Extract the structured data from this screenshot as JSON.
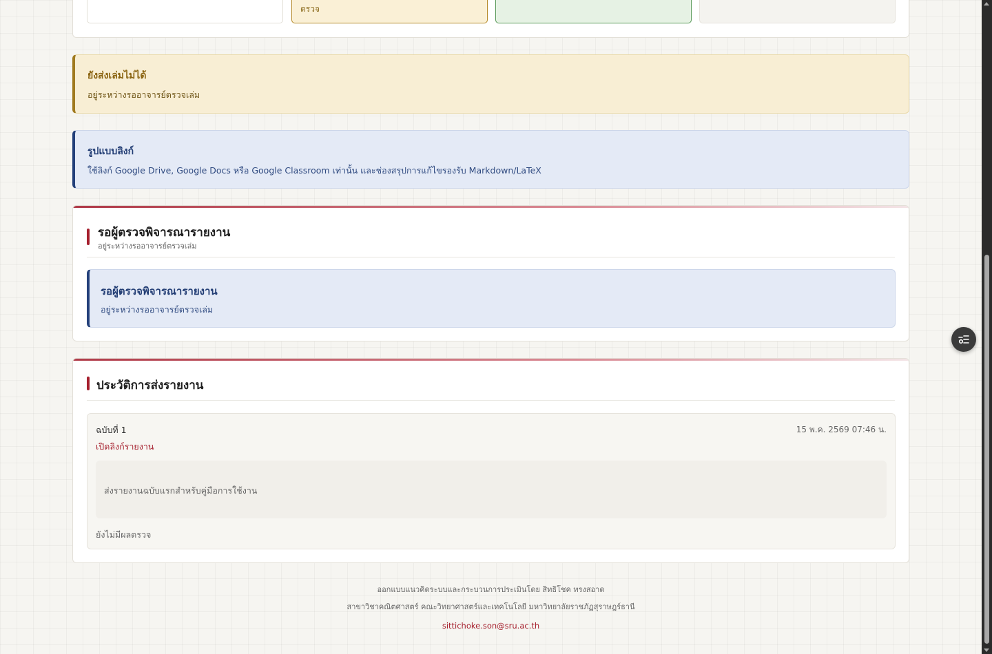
{
  "stats": {
    "pending_label": "ตรวจ"
  },
  "notice_submit": {
    "title": "ยังส่งเล่มไม่ได้",
    "text": "อยู่ระหว่างรออาจารย์ตรวจเล่ม"
  },
  "notice_link_format": {
    "title": "รูปแบบลิงก์",
    "text": "ใช้ลิงก์ Google Drive, Google Docs หรือ Google Classroom เท่านั้น และช่องสรุปการแก้ไขรองรับ Markdown/LaTeX"
  },
  "review_card": {
    "title": "รอผู้ตรวจพิจารณารายงาน",
    "subtitle": "อยู่ระหว่างรออาจารย์ตรวจเล่ม",
    "alert_title": "รอผู้ตรวจพิจารณารายงาน",
    "alert_text": "อยู่ระหว่างรออาจารย์ตรวจเล่ม"
  },
  "history_card": {
    "title": "ประวัติการส่งรายงาน",
    "entries": [
      {
        "version": "ฉบับที่ 1",
        "date": "15 พ.ค. 2569 07:46 น.",
        "link_label": "เปิดลิงก์รายงาน",
        "note": "ส่งรายงานฉบับแรกสำหรับคู่มือการใช้งาน",
        "result": "ยังไม่มีผลตรวจ"
      }
    ]
  },
  "footer": {
    "line1": "ออกแบบแนวคิดระบบและกระบวนการประเมินโดย สิทธิโชค ทรงสอาด",
    "line2": "สาขาวิชาคณิตศาสตร์ คณะวิทยาศาสตร์และเทคโนโลยี มหาวิทยาลัยราชภัฏสุราษฎร์ธานี",
    "email": "sittichoke.son@sru.ac.th"
  },
  "colors": {
    "accent": "#a51f2d",
    "warning": "#a07a1e",
    "info": "#23407a"
  },
  "icons": {
    "fab": "toggle-menu-icon"
  }
}
